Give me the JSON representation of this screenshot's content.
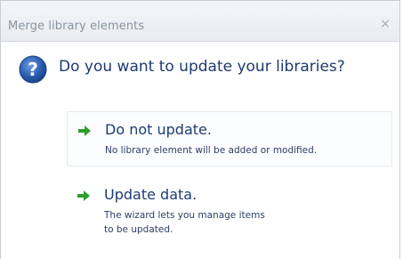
{
  "window": {
    "title": "Merge library elements",
    "close_glyph": "×"
  },
  "question": {
    "icon": "question-icon",
    "text": "Do you want to update your libraries?"
  },
  "options": [
    {
      "icon": "green-arrow-icon",
      "title": "Do not update.",
      "description": "No library element will be added or modified."
    },
    {
      "icon": "green-arrow-icon",
      "title": "Update data.",
      "description": "The wizard lets you manage items to be updated."
    }
  ],
  "colors": {
    "accent_green": "#2e9e2e",
    "question_blue": "#2a5db0",
    "text_blue": "#1e3b73"
  }
}
